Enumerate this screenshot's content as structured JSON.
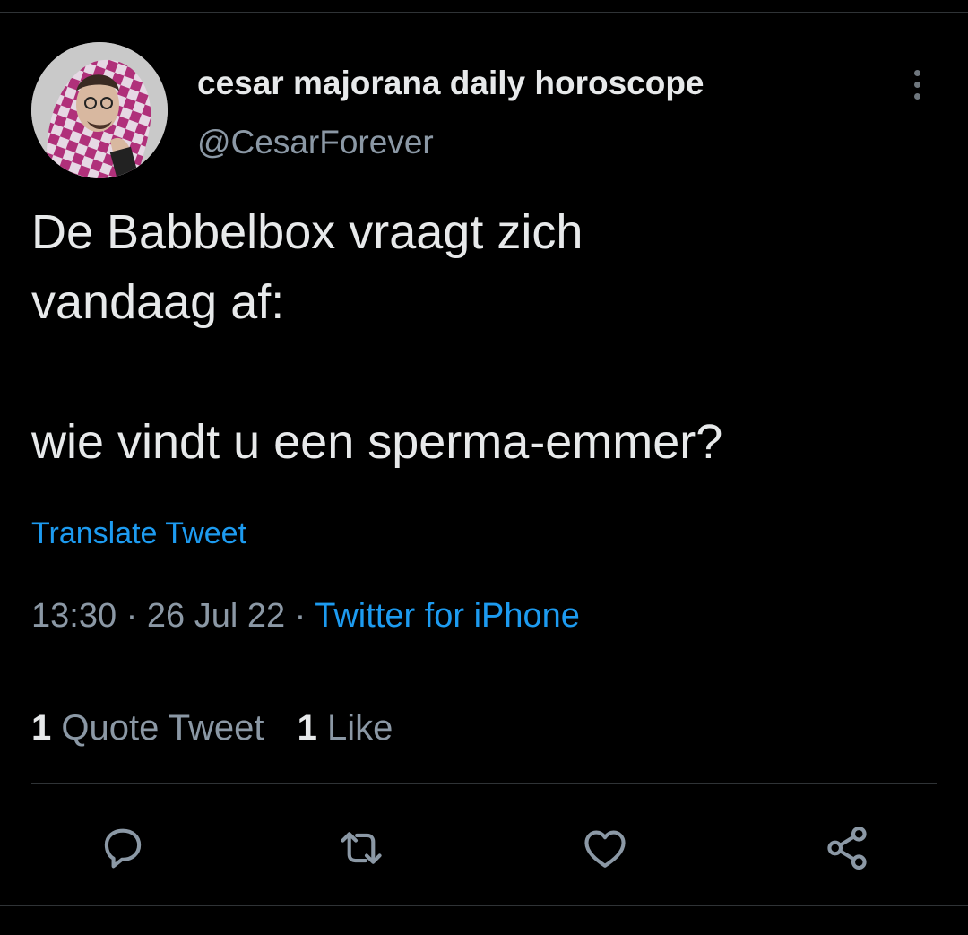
{
  "header": {
    "display_name": "cesar majorana daily horoscope",
    "handle": "@CesarForever"
  },
  "tweet": {
    "text_line_1": "De Babbelbox vraagt zich",
    "text_line_2": "vandaag af:",
    "text_line_3": "wie vindt u een sperma-emmer?",
    "translate_label": "Translate Tweet",
    "time": "13:30",
    "date": "26 Jul 22",
    "separator": "·",
    "source": "Twitter for iPhone"
  },
  "stats": {
    "quote_count": "1",
    "quote_label": "Quote Tweet",
    "like_count": "1",
    "like_label": "Like"
  },
  "actions": {
    "reply": "reply-icon",
    "retweet": "retweet-icon",
    "like": "heart-icon",
    "share": "share-icon"
  },
  "colors": {
    "background": "#000000",
    "text": "#e7e9ea",
    "muted": "#8b98a5",
    "accent": "#1d9bf0",
    "divider": "#2f3336"
  }
}
